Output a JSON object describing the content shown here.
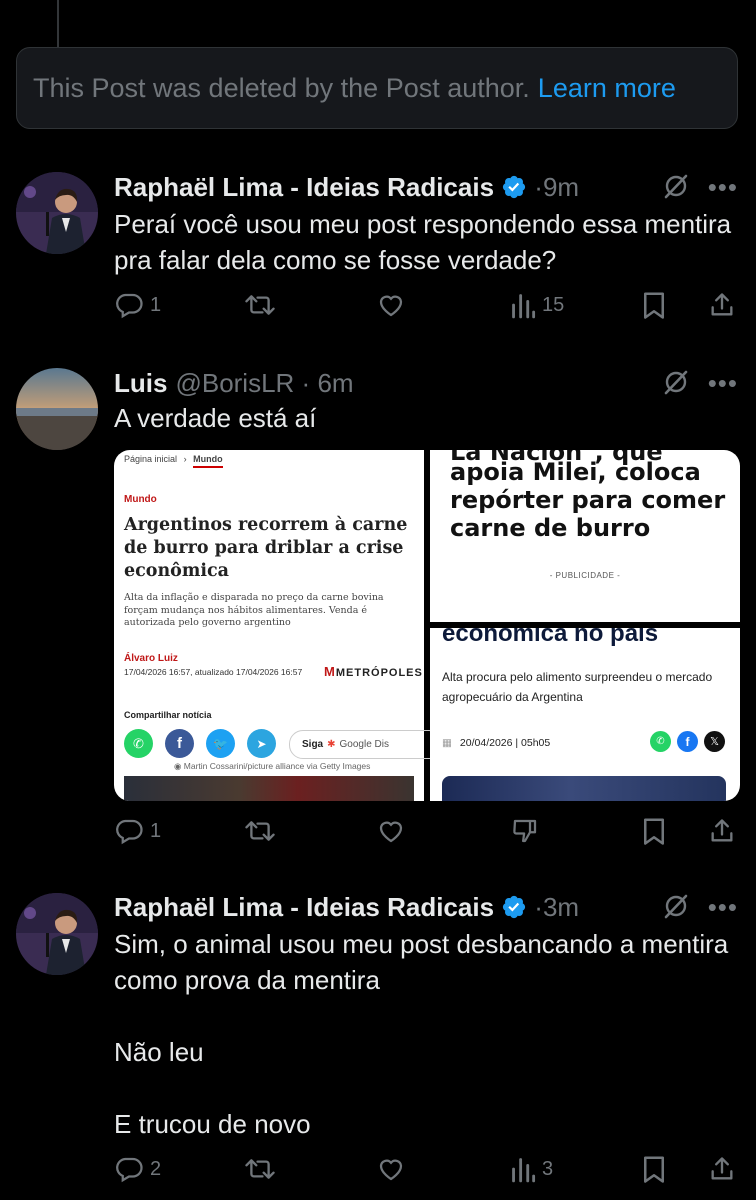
{
  "deleted_notice": {
    "text": "This Post was deleted by the Post author.",
    "link": "Learn more"
  },
  "posts": [
    {
      "name": "Raphaël Lima - Ideias Radicais",
      "handle": "",
      "time": "9m",
      "text": "Peraí você usou meu post respondendo essa mentira pra falar dela como se fosse verdade?",
      "replies": "1",
      "reposts": "",
      "likes": "",
      "views": "15"
    },
    {
      "name": "Luis",
      "handle": "@BorisLR",
      "time": "6m",
      "text": "A verdade está aí",
      "replies": "1",
      "reposts": "",
      "likes": ""
    },
    {
      "name": "Raphaël Lima - Ideias Radicais",
      "handle": "",
      "time": "3m",
      "text": "Sim, o animal usou meu post desbancando a mentira como prova da mentira\n\nNão leu\n\nE trucou de novo",
      "replies": "2",
      "reposts": "",
      "likes": "",
      "views": "3"
    }
  ],
  "media_left": {
    "breadcrumb_home": "Página inicial",
    "breadcrumb_section": "Mundo",
    "section": "Mundo",
    "headline": "Argentinos recorrem à carne de burro para driblar a crise econômica",
    "lede": "Alta da inflação e disparada no preço da carne bovina forçam mudança nos hábitos alimentares. Venda é autorizada pelo governo argentino",
    "author": "Álvaro Luiz",
    "date": "17/04/2026 16:57, atualizado 17/04/2026 16:57",
    "brand": "METRÓPOLES",
    "share_label": "Compartilhar notícia",
    "follow": "Siga",
    "google": "Google Dis",
    "credit": "Martin Cossarini/picture alliance via Getty Images"
  },
  "media_right_top": {
    "headline_partial": "La Nación\", que",
    "headline": "apoia Milei, coloca repórter para comer carne de burro",
    "ad": "- PUBLICIDADE -"
  },
  "media_right_bottom": {
    "headline_partial": "econômica no país",
    "lede": "Alta procura pelo alimento surpreendeu o mercado agropecuário da Argentina",
    "date": "20/04/2026 | 05h05"
  },
  "colors": {
    "verified": "#1d9bf0",
    "muted": "#71767b",
    "text": "#e7e9ea",
    "link": "#1d9bf0"
  }
}
